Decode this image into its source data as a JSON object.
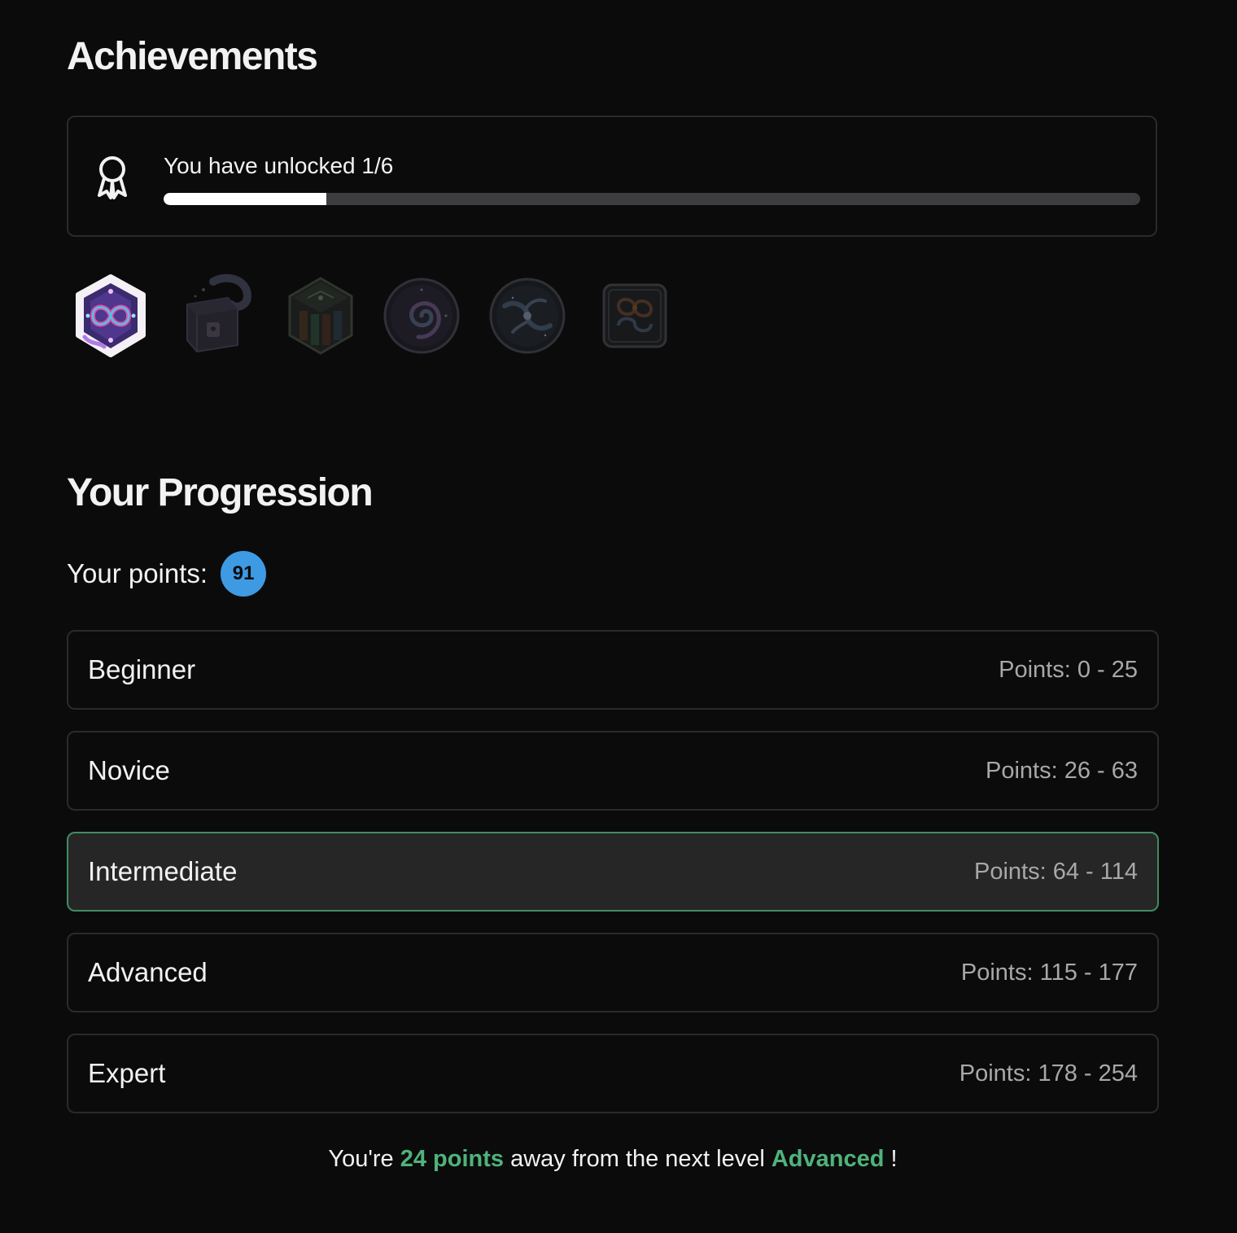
{
  "achievements": {
    "title": "Achievements",
    "unlock_text": "You have unlocked 1/6",
    "unlocked": 1,
    "total": 6,
    "badges": [
      {
        "name": "infinity-knot-badge",
        "unlocked": true
      },
      {
        "name": "treasure-chest-badge",
        "unlocked": false
      },
      {
        "name": "circuit-hexagon-badge",
        "unlocked": false
      },
      {
        "name": "spiral-badge",
        "unlocked": false
      },
      {
        "name": "galaxy-badge",
        "unlocked": false
      },
      {
        "name": "knot-square-badge",
        "unlocked": false
      }
    ]
  },
  "progression": {
    "title": "Your Progression",
    "points_label": "Your points:",
    "points": "91",
    "levels": [
      {
        "name": "Beginner",
        "range": "Points: 0 - 25",
        "current": false
      },
      {
        "name": "Novice",
        "range": "Points: 26 - 63",
        "current": false
      },
      {
        "name": "Intermediate",
        "range": "Points: 64 - 114",
        "current": true
      },
      {
        "name": "Advanced",
        "range": "Points: 115 - 177",
        "current": false
      },
      {
        "name": "Expert",
        "range": "Points: 178 - 254",
        "current": false
      }
    ],
    "next_level": {
      "prefix": "You're",
      "points_away": "24 points",
      "middle": "away from the next level",
      "level": "Advanced",
      "suffix": "!"
    }
  },
  "colors": {
    "background": "#0b0b0c",
    "accent_green": "#4fb37a",
    "points_blue": "#3f9ae4"
  }
}
